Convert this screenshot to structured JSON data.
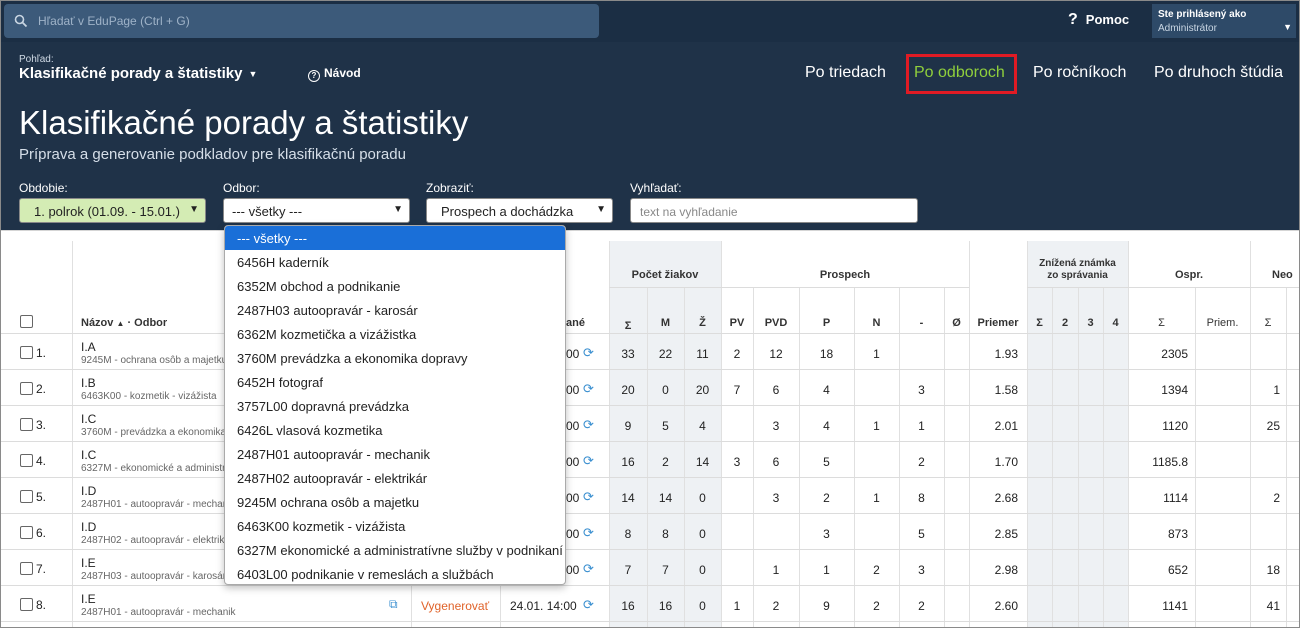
{
  "topbar": {
    "search_placeholder": "Hľadať v EduPage (Ctrl + G)",
    "help_icon": "question-icon",
    "help_label": "Pomoc",
    "user_line1": "Ste prihlásený ako",
    "user_line2": "Administrátor"
  },
  "header": {
    "pohlad_label": "Pohľad:",
    "pohlad_value": "Klasifikačné porady a štatistiky",
    "navod": "Návod",
    "nav": [
      "Po triedach",
      "Po odboroch",
      "Po ročníkoch",
      "Po druhoch štúdia"
    ],
    "active_nav": "Po odboroch",
    "title": "Klasifikačné porady a štatistiky",
    "subtitle": "Príprava a generovanie podkladov pre klasifikačnú poradu"
  },
  "filters": {
    "obdobie_label": "Obdobie:",
    "obdobie_value": "1. polrok (01.09. - 15.01.)",
    "odbor_label": "Odbor:",
    "odbor_value": "--- všetky ---",
    "zobrazit_label": "Zobraziť:",
    "zobrazit_value": "Prospech a dochádzka",
    "vyhladat_label": "Vyhľadať:",
    "vyhladat_placeholder": "text na vyhľadanie"
  },
  "colors": {
    "accent": "#8fcf3c",
    "header_bg": "#1f3248",
    "highlight": "#e01b24",
    "dropdown_selected": "#1a6fd8",
    "link": "#e0632a"
  },
  "odbor_options": [
    "--- všetky ---",
    "6456H kaderník",
    "6352M obchod a podnikanie",
    "2487H03 autoopravár - karosár",
    "6362M kozmetička a vizážistka",
    "3760M prevádzka a ekonomika dopravy",
    "6452H fotograf",
    "3757L00 dopravná prevádzka",
    "6426L vlasová kozmetika",
    "2487H01 autoopravár - mechanik",
    "2487H02 autoopravár - elektrikár",
    "9245M ochrana osôb a majetku",
    "6463K00 kozmetik - vizážista",
    "6327M ekonomické a administratívne služby v podnikaní",
    "6403L00 podnikanie v remeslách a službách"
  ],
  "table": {
    "headers": {
      "nazov": "Názov",
      "odbor": "Odbor",
      "sort_icon": "sort-asc-icon",
      "generovane_partial": "ané",
      "pocet_ziakov": "Počet žiakov",
      "prospech": "Prospech",
      "znizena_line1": "Znížená známka",
      "znizena_line2": "zo správania",
      "ospr": "Ospr.",
      "neospr_partial": "Neo",
      "sum": "Σ",
      "m": "M",
      "z": "Ž",
      "pv": "PV",
      "pvd": "PVD",
      "p": "P",
      "n": "N",
      "dash": "-",
      "avg": "Ø",
      "priemer": "Priemer",
      "z2": "2",
      "z3": "3",
      "z4": "4",
      "priem": "Priem."
    },
    "rows": [
      {
        "num": "1.",
        "name": "I.A",
        "odbor": "9245M - ochrana osôb a majetku",
        "time": "00",
        "sum": "33",
        "m": "22",
        "z": "11",
        "pv": "2",
        "pvd": "12",
        "p": "18",
        "n": "1",
        "dash": "",
        "priemer": "1.93",
        "ospr": "2305",
        "neo": ""
      },
      {
        "num": "2.",
        "name": "I.B",
        "odbor": "6463K00 - kozmetik - vizážista",
        "time": "00",
        "sum": "20",
        "m": "0",
        "z": "20",
        "pv": "7",
        "pvd": "6",
        "p": "4",
        "n": "",
        "dash": "3",
        "priemer": "1.58",
        "ospr": "1394",
        "neo": "1"
      },
      {
        "num": "3.",
        "name": "I.C",
        "odbor": "3760M - prevádzka a ekonomika dopravy",
        "time": "00",
        "sum": "9",
        "m": "5",
        "z": "4",
        "pv": "",
        "pvd": "3",
        "p": "4",
        "n": "1",
        "dash": "1",
        "priemer": "2.01",
        "ospr": "1120",
        "neo": "25"
      },
      {
        "num": "4.",
        "name": "I.C",
        "odbor": "6327M - ekonomické a administratívne služby",
        "time": "00",
        "sum": "16",
        "m": "2",
        "z": "14",
        "pv": "3",
        "pvd": "6",
        "p": "5",
        "n": "",
        "dash": "2",
        "priemer": "1.70",
        "ospr": "1185.8",
        "neo": ""
      },
      {
        "num": "5.",
        "name": "I.D",
        "odbor": "2487H01 - autoopravár - mechanik",
        "time": "00",
        "sum": "14",
        "m": "14",
        "z": "0",
        "pv": "",
        "pvd": "3",
        "p": "2",
        "n": "1",
        "dash": "8",
        "priemer": "2.68",
        "ospr": "1114",
        "neo": "2"
      },
      {
        "num": "6.",
        "name": "I.D",
        "odbor": "2487H02 - autoopravár - elektrikár",
        "time": "00",
        "sum": "8",
        "m": "8",
        "z": "0",
        "pv": "",
        "pvd": "",
        "p": "3",
        "n": "",
        "dash": "5",
        "priemer": "2.85",
        "ospr": "873",
        "neo": ""
      },
      {
        "num": "7.",
        "name": "I.E",
        "odbor": "2487H03 - autoopravár - karosár",
        "time": "00",
        "sum": "7",
        "m": "7",
        "z": "0",
        "pv": "",
        "pvd": "1",
        "p": "1",
        "n": "2",
        "dash": "3",
        "priemer": "2.98",
        "ospr": "652",
        "neo": "18"
      },
      {
        "num": "8.",
        "name": "I.E",
        "odbor": "2487H01 - autoopravár - mechanik",
        "gen": "Vygenerovať",
        "time": "24.01. 14:00",
        "sum": "16",
        "m": "16",
        "z": "0",
        "pv": "1",
        "pvd": "2",
        "p": "9",
        "n": "2",
        "dash": "2",
        "priemer": "2.60",
        "ospr": "1141",
        "neo": "41"
      }
    ]
  }
}
